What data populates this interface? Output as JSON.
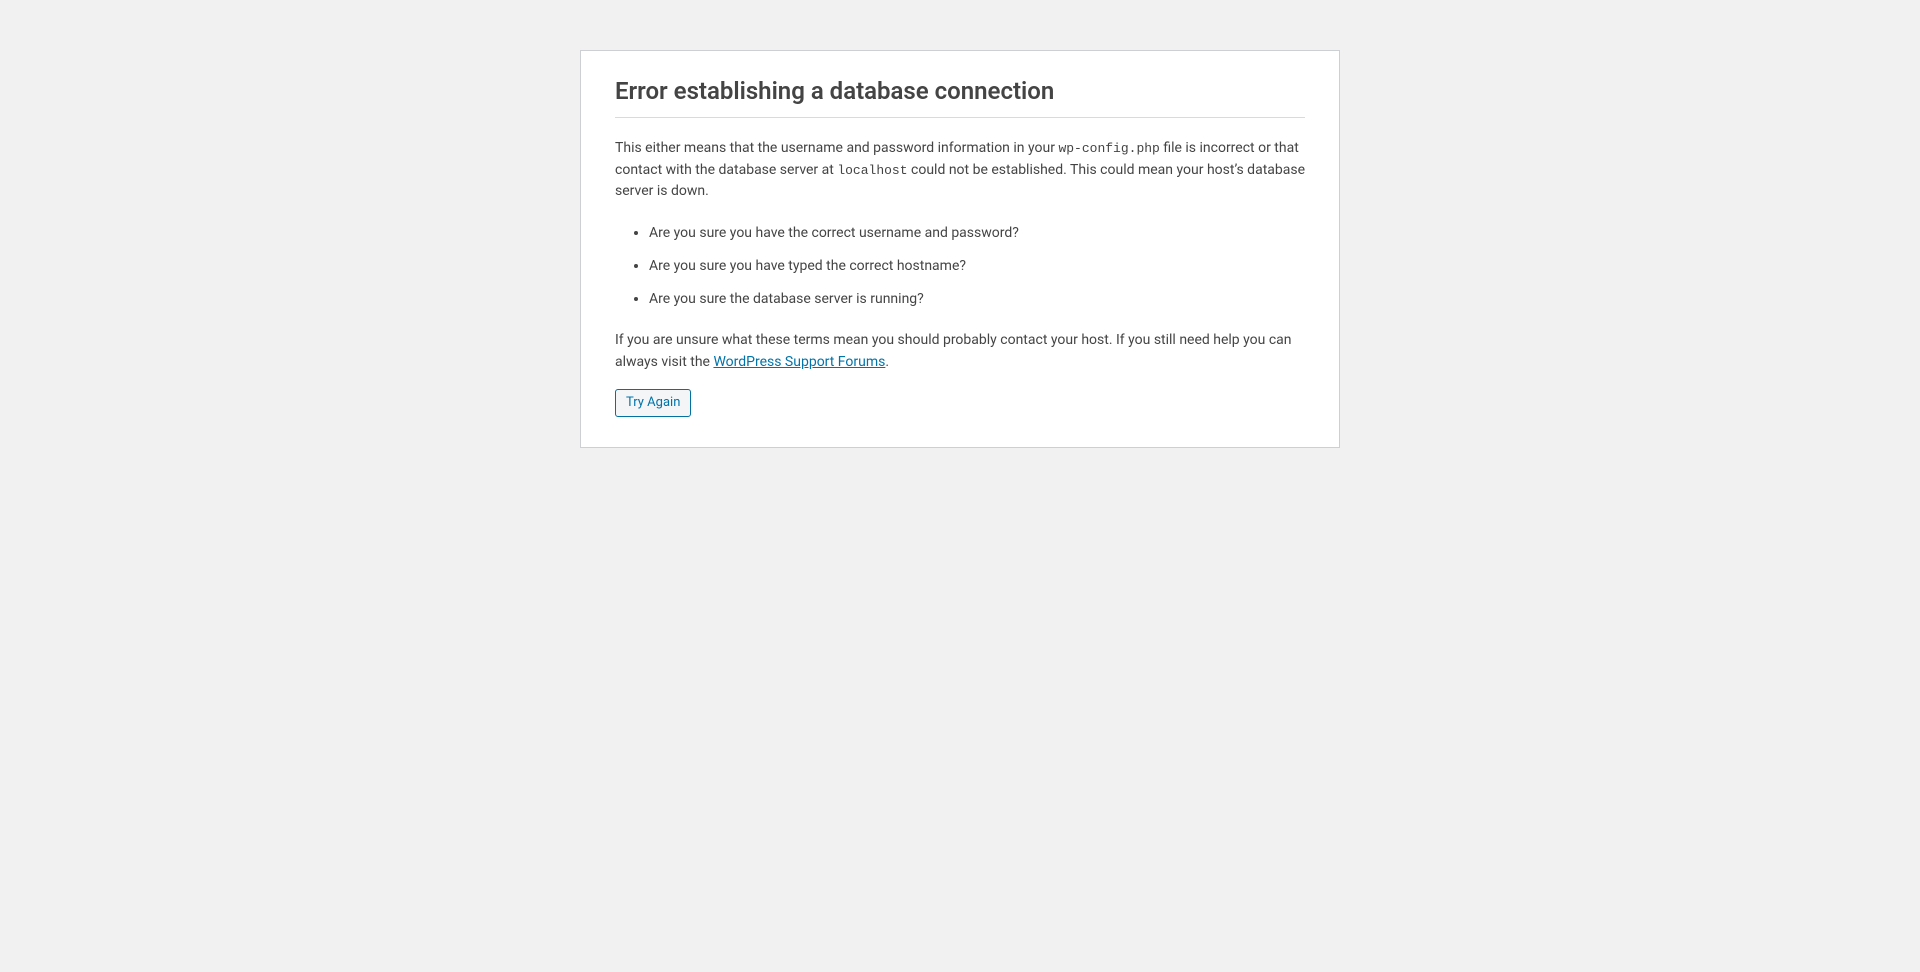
{
  "heading": "Error establishing a database connection",
  "explain_part1": "This either means that the username and password information in your ",
  "config_file": "wp-config.php",
  "explain_part2": " file is incorrect or that contact with the database server at ",
  "host_name": "localhost",
  "explain_part3": " could not be established. This could mean your host’s database server is down.",
  "checks": [
    "Are you sure you have the correct username and password?",
    "Are you sure you have typed the correct hostname?",
    "Are you sure the database server is running?"
  ],
  "help_part1": "If you are unsure what these terms mean you should probably contact your host. If you still need help you can always visit the ",
  "support_link_text": "WordPress Support Forums",
  "help_part2": ".",
  "try_again_label": "Try Again"
}
